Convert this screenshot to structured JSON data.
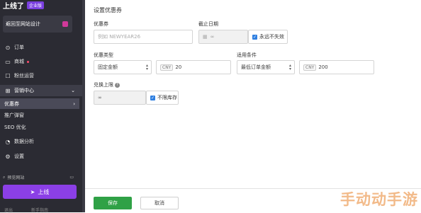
{
  "brand": {
    "name": "上线了",
    "badge": "企业版"
  },
  "sidebar": {
    "back_label": "返回至网站设计",
    "items": [
      {
        "label": "订单",
        "icon": "order-icon"
      },
      {
        "label": "商城",
        "icon": "shop-icon"
      },
      {
        "label": "粉丝运营",
        "icon": "fans-icon"
      },
      {
        "label": "营销中心",
        "icon": "marketing-icon"
      },
      {
        "label": "数据分析",
        "icon": "analytics-icon"
      },
      {
        "label": "设置",
        "icon": "gear-icon"
      }
    ],
    "subitems": [
      "优惠券",
      "推广弹窗",
      "SEO 优化"
    ],
    "preview_label": "预览网站",
    "launch_label": "上线",
    "footer": [
      "退出",
      "新手指南"
    ]
  },
  "form": {
    "title": "设置优惠券",
    "coupon_label": "优惠券",
    "coupon_placeholder": "例如 NEWYEAR26",
    "deadline_label": "截止日期",
    "deadline_value": "∞",
    "never_expire_label": "永远不失效",
    "coupon_type_label": "优惠类型",
    "coupon_type_value": "固定金额",
    "currency": "CNY",
    "amount_value": "20",
    "condition_label": "适用条件",
    "condition_value": "最低订单金额",
    "min_amount_value": "200",
    "limit_label": "兑换上限",
    "limit_value": "∞",
    "unlimited_label": "不限库存"
  },
  "actions": {
    "save": "保存",
    "cancel": "取消"
  },
  "watermark": "手动动手游",
  "colors": {
    "sidebar": "#2b2b33",
    "accent": "#8b3fe6",
    "save": "#2fa146",
    "checkbox": "#2f7fe0"
  }
}
